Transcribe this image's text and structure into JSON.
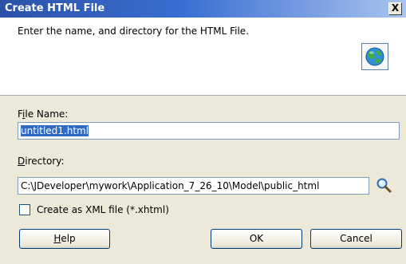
{
  "window": {
    "title": "Create HTML File",
    "close_glyph": "X"
  },
  "header": {
    "description": "Enter the name, and directory for the HTML File.",
    "icon": "globe-icon"
  },
  "file_name": {
    "label_prefix": "F",
    "label_mnemonic": "i",
    "label_suffix": "le Name:",
    "value": "untitled1.html"
  },
  "directory": {
    "label_mnemonic": "D",
    "label_suffix": "irectory:",
    "value": "C:\\JDeveloper\\mywork\\Application_7_26_10\\Model\\public_html",
    "browse_icon": "search-icon"
  },
  "xml_option": {
    "label": "Create as XML file (*.xhtml)",
    "checked": false
  },
  "buttons": {
    "help_mnemonic": "H",
    "help_suffix": "elp",
    "ok": "OK",
    "cancel": "Cancel"
  }
}
